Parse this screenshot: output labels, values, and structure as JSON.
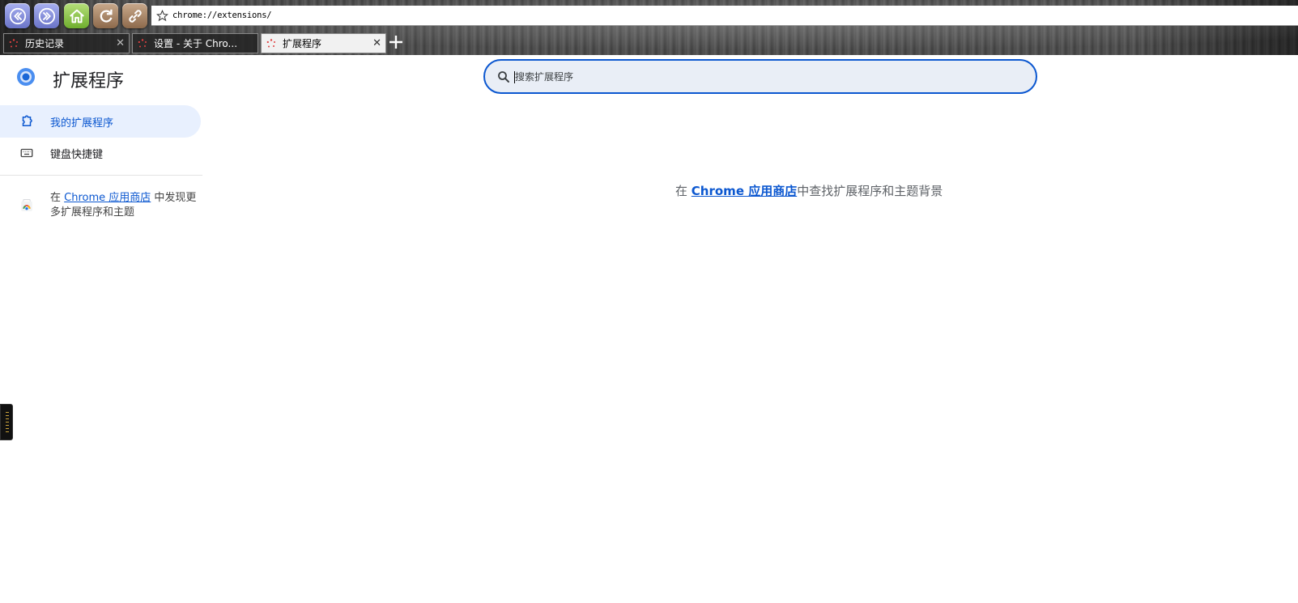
{
  "browser": {
    "address_url": "chrome://extensions/",
    "tabs": [
      {
        "label": "历史记录"
      },
      {
        "label": "设置 - 关于 Chro..."
      },
      {
        "label": "扩展程序"
      }
    ]
  },
  "page": {
    "title": "扩展程序",
    "search_placeholder": "搜索扩展程序"
  },
  "sidebar": {
    "items": [
      {
        "label": "我的扩展程序",
        "selected": true
      },
      {
        "label": "键盘快捷键",
        "selected": false
      }
    ],
    "store_prefix": "在",
    "store_link": "Chrome 应用商店",
    "store_suffix": "中发现更多扩展程序和主题"
  },
  "main": {
    "empty_prefix": "在",
    "empty_link": "Chrome 应用商店",
    "empty_suffix": "中查找扩展程序和主题背景"
  },
  "colors": {
    "accent": "#0b57d0",
    "selected_bg": "#e8f0fe",
    "search_bg": "#e9eef6"
  }
}
